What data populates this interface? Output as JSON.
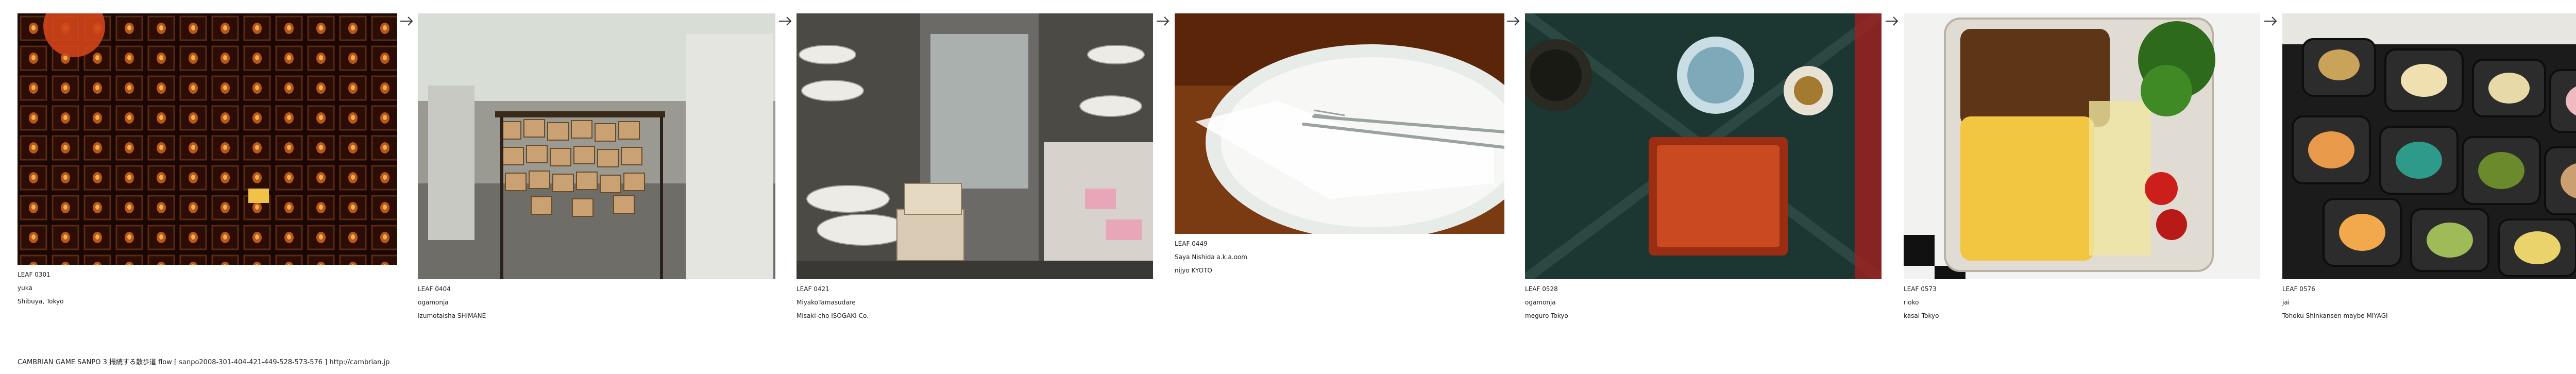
{
  "leaves": [
    {
      "id": "LEAF 0301",
      "user": "yuka",
      "place": "Shibuya, Tokyo",
      "icon": "lanterns-photo"
    },
    {
      "id": "LEAF 0404",
      "user": "ogamonja",
      "place": "Izumotaisha SHIMANE",
      "icon": "ema-shrine-photo"
    },
    {
      "id": "LEAF 0421",
      "user": "MiyakoTamasudare",
      "place": "Misaki-cho ISOGAKI Co.",
      "icon": "dish-store-photo"
    },
    {
      "id": "LEAF 0449",
      "user": "Saya Nishida a.k.a.oom",
      "place": "nijyo  KYOTO",
      "icon": "plate-fork-photo"
    },
    {
      "id": "LEAF 0528",
      "user": "ogamonja",
      "place": "meguro Tokyo",
      "icon": "table-dishes-photo"
    },
    {
      "id": "LEAF 0573",
      "user": "rioko",
      "place": "kasai Tokyo",
      "icon": "bento-soboro-photo"
    },
    {
      "id": "LEAF 0576",
      "user": "jai",
      "place": "Tohoku Shinkansen maybe MIYAGI",
      "icon": "bento-box-photo"
    }
  ],
  "arrow_icon": "right-arrow-icon",
  "footer": "CAMBRIAN GAME  SANPO 3 撮続する散歩道 flow [ sanpo2008-301-404-421-449-528-573-576 ]   http://cambrian.jp"
}
